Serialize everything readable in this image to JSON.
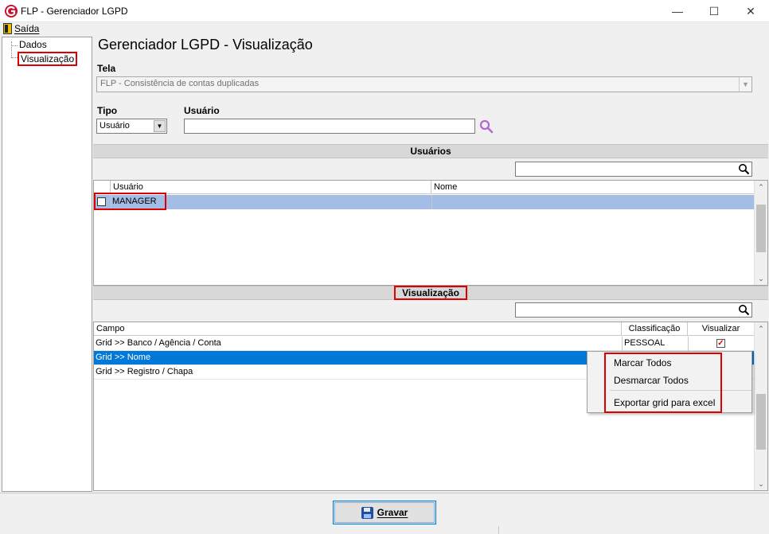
{
  "window": {
    "title": "FLP - Gerenciador LGPD",
    "minimize_glyph": "—",
    "maximize_glyph": "☐",
    "close_glyph": "✕"
  },
  "menu": {
    "saida": "Saída"
  },
  "tree": {
    "items": [
      {
        "label": "Dados"
      },
      {
        "label": "Visualização"
      }
    ]
  },
  "page": {
    "title": "Gerenciador LGPD - Visualização"
  },
  "form": {
    "tela_label": "Tela",
    "tela_value": "FLP - Consistência de contas duplicadas",
    "tipo_label": "Tipo",
    "tipo_value": "Usuário",
    "usuario_label": "Usuário",
    "usuario_value": ""
  },
  "usuarios": {
    "section_title": "Usuários",
    "columns": [
      "Usuário",
      "Nome"
    ],
    "rows": [
      {
        "usuario": "MANAGER",
        "nome": "",
        "checked": false
      }
    ]
  },
  "visualizacao": {
    "section_title": "Visualização",
    "columns": [
      "Campo",
      "Classificação",
      "Visualizar"
    ],
    "rows": [
      {
        "campo": "Grid >> Banco / Agência / Conta",
        "classificacao": "PESSOAL",
        "visualizar": true
      },
      {
        "campo": "Grid >> Nome",
        "classificacao": "",
        "visualizar": false
      },
      {
        "campo": "Grid >> Registro / Chapa",
        "classificacao": "",
        "visualizar": false
      }
    ]
  },
  "context_menu": {
    "items": [
      "Marcar Todos",
      "Desmarcar Todos",
      "Exportar grid para excel"
    ]
  },
  "footer": {
    "gravar_label": "Gravar"
  },
  "colors": {
    "selection_blue": "#0078d7",
    "highlight_row": "#a3bde6",
    "annotation_red": "#e00000"
  }
}
